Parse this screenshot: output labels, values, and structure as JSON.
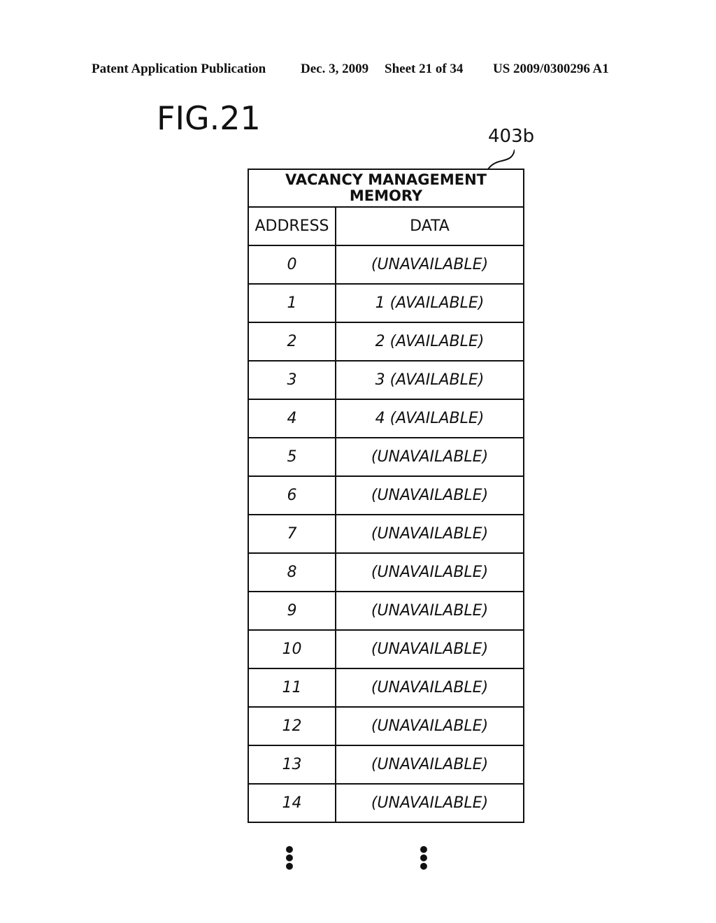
{
  "header": {
    "publication": "Patent Application Publication",
    "date": "Dec. 3, 2009",
    "sheet": "Sheet 21 of 34",
    "number": "US 2009/0300296 A1"
  },
  "figure": {
    "label": "FIG.21",
    "reference": "403b"
  },
  "table": {
    "title": "VACANCY MANAGEMENT MEMORY",
    "columns": [
      "ADDRESS",
      "DATA"
    ],
    "rows": [
      {
        "address": "0",
        "data": "(UNAVAILABLE)"
      },
      {
        "address": "1",
        "data": "1 (AVAILABLE)"
      },
      {
        "address": "2",
        "data": "2 (AVAILABLE)"
      },
      {
        "address": "3",
        "data": "3 (AVAILABLE)"
      },
      {
        "address": "4",
        "data": "4 (AVAILABLE)"
      },
      {
        "address": "5",
        "data": "(UNAVAILABLE)"
      },
      {
        "address": "6",
        "data": "(UNAVAILABLE)"
      },
      {
        "address": "7",
        "data": "(UNAVAILABLE)"
      },
      {
        "address": "8",
        "data": "(UNAVAILABLE)"
      },
      {
        "address": "9",
        "data": "(UNAVAILABLE)"
      },
      {
        "address": "10",
        "data": "(UNAVAILABLE)"
      },
      {
        "address": "11",
        "data": "(UNAVAILABLE)"
      },
      {
        "address": "12",
        "data": "(UNAVAILABLE)"
      },
      {
        "address": "13",
        "data": "(UNAVAILABLE)"
      },
      {
        "address": "14",
        "data": "(UNAVAILABLE)"
      }
    ],
    "continuation": "⋮"
  }
}
